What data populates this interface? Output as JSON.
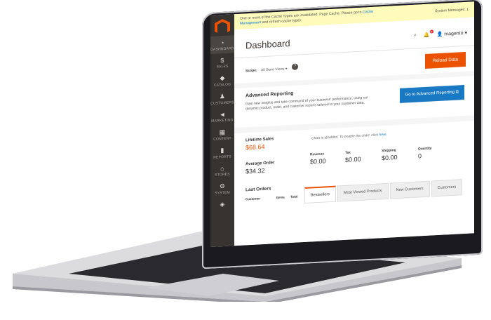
{
  "colors": {
    "accent": "#eb5202",
    "sidebar": "#373330",
    "primary_button": "#1979c3",
    "message_bg": "#fffbbb"
  },
  "sidebar": {
    "items": [
      {
        "label": "DASHBOARD",
        "icon": "speedometer-icon"
      },
      {
        "label": "SALES",
        "icon": "dollar-icon"
      },
      {
        "label": "CATALOG",
        "icon": "cube-icon"
      },
      {
        "label": "CUSTOMERS",
        "icon": "person-icon"
      },
      {
        "label": "MARKETING",
        "icon": "megaphone-icon"
      },
      {
        "label": "CONTENT",
        "icon": "layout-icon"
      },
      {
        "label": "REPORTS",
        "icon": "bar-chart-icon"
      },
      {
        "label": "STORES",
        "icon": "store-icon"
      },
      {
        "label": "SYSTEM",
        "icon": "gear-icon"
      },
      {
        "label": "",
        "icon": "box-icon"
      }
    ]
  },
  "message": {
    "text": "One or more of the Cache Types are invalidated: Page Cache. Please go to",
    "link": "Cache Management",
    "text2": "and refresh cache types.",
    "system": "System Messages: 1"
  },
  "header": {
    "title": "Dashboard",
    "user": "magento"
  },
  "scope": {
    "label": "Scope:",
    "value": "All Store Views",
    "reload": "Reload Data"
  },
  "advanced": {
    "title": "Advanced Reporting",
    "desc": "Gain new insights and take command of your business' performance, using our dynamic product, order, and customer reports tailored to your customer data.",
    "button": "Go to Advanced Reporting"
  },
  "stats": {
    "lifetime_label": "Lifetime Sales",
    "lifetime_value": "$68.64",
    "avg_label": "Average Order",
    "avg_value": "$34.32",
    "chart_msg": "Chart is disabled. To enable the chart, click",
    "chart_link": "here."
  },
  "metrics": [
    {
      "label": "Revenue",
      "value": "$0.00",
      "accent": true
    },
    {
      "label": "Tax",
      "value": "$0.00",
      "accent": false
    },
    {
      "label": "Shipping",
      "value": "$0.00",
      "accent": false
    },
    {
      "label": "Quantity",
      "value": "0",
      "accent": false
    }
  ],
  "orders": {
    "title": "Last Orders",
    "columns": [
      "Customer",
      "Items",
      "Total"
    ]
  },
  "tabs": [
    "Bestsellers",
    "Most Viewed Products",
    "New Customers",
    "Customers"
  ]
}
